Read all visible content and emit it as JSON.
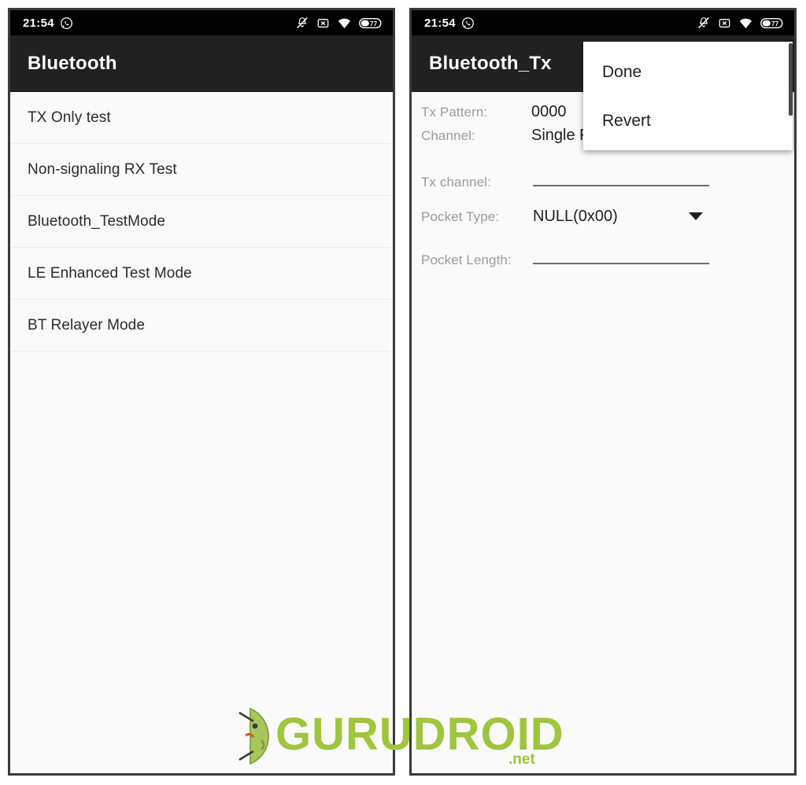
{
  "statusbar": {
    "time": "21:54",
    "notification_icon": "whatsapp-icon",
    "icons": [
      "vibrate-off-icon",
      "data-off-icon",
      "wifi-icon",
      "battery-icon"
    ],
    "battery_level": "77"
  },
  "left_screen": {
    "title": "Bluetooth",
    "list": [
      {
        "label": "TX Only test"
      },
      {
        "label": "Non-signaling RX Test"
      },
      {
        "label": "Bluetooth_TestMode"
      },
      {
        "label": "LE Enhanced Test Mode"
      },
      {
        "label": "BT Relayer Mode"
      }
    ]
  },
  "right_screen": {
    "title": "Bluetooth_Tx",
    "fields": {
      "tx_pattern_label": "Tx Pattern:",
      "tx_pattern_value": "0000",
      "channel_label": "Channel:",
      "channel_value": "Single Frequency",
      "tx_channel_label": "Tx channel:",
      "tx_channel_value": "",
      "tx_channel_placeholder": "",
      "pocket_type_label": "Pocket Type:",
      "pocket_type_value": "NULL(0x00)",
      "pocket_length_label": "Pocket Length:",
      "pocket_length_value": "",
      "pocket_length_placeholder": ""
    },
    "overflow_menu": {
      "items": [
        {
          "label": "Done"
        },
        {
          "label": "Revert"
        }
      ]
    }
  },
  "watermark": {
    "text": "GURUDROID",
    "suffix": ".net",
    "color": "#9fc53d",
    "mascot": "android-head-icon"
  }
}
